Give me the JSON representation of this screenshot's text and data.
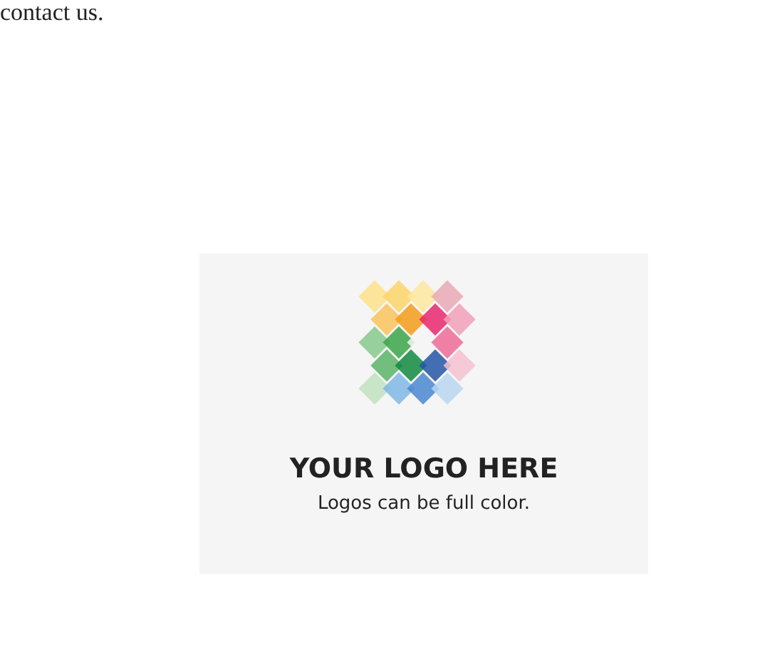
{
  "intro": {
    "text": "contact us."
  },
  "logo_sample": {
    "title": "YOUR LOGO HERE",
    "caption": "Logos can be full color."
  }
}
